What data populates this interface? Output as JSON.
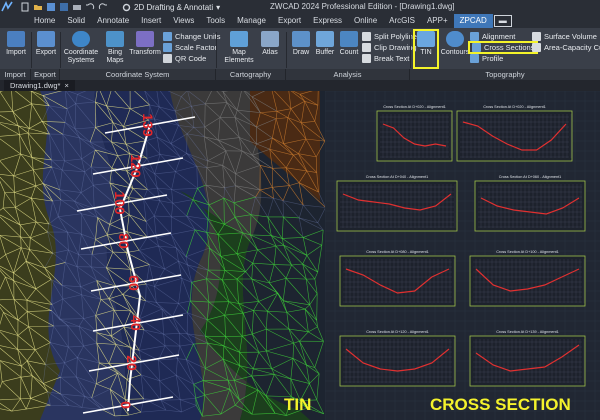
{
  "titlebar": {
    "workspace": "2D Drafting & Annotati",
    "title": "ZWCAD 2024 Professional Edition - [Drawing1.dwg]"
  },
  "tabs": [
    "Home",
    "Solid",
    "Annotate",
    "Insert",
    "Views",
    "Tools",
    "Manage",
    "Export",
    "Express",
    "Online",
    "ArcGIS",
    "APP+",
    "ZPCAD"
  ],
  "active_tab": "ZPCAD",
  "ribbon": {
    "import": "Import",
    "export": "Export",
    "coord_systems": "Coordinate Systems",
    "bing_maps": "Bing Maps",
    "transform": "Transform",
    "change_units": "Change Units",
    "scale_factor": "Scale Factor",
    "qr_code": "QR Code",
    "map_elements": "Map Elements",
    "atlas": "Atlas",
    "draw": "Draw",
    "buffer": "Buffer",
    "count": "Count",
    "split_polyline": "Split Polyline",
    "clip_drawing": "Clip Drawing",
    "break_text": "Break Text",
    "tin": "TIN",
    "contours": "Contours",
    "alignment": "Alignment",
    "cross_sections": "Cross Sections",
    "profile": "Profile",
    "surface_volume": "Surface Volume",
    "area_capacity": "Area-Capacity Curve",
    "groups": [
      "Import",
      "Export",
      "Coordinate System",
      "Cartography",
      "Analysis",
      "Topography"
    ]
  },
  "filetab": "Drawing1.dwg*",
  "stations": [
    "139",
    "120",
    "100",
    "80",
    "60",
    "40",
    "20",
    "0"
  ],
  "sections": [
    "Cross Section At D+020 - Alignment1",
    "Cross Section At D+020 - Alignment1",
    "Cross Section At D+040 - Alignment1",
    "Cross Section At D+060 - Alignment1",
    "Cross Section At D+080 - Alignment1",
    "Cross Section At D+100 - Alignment1",
    "Cross Section At D+120 - Alignment1",
    "Cross Section At D+139 - Alignment1"
  ],
  "labels": {
    "left": "TIN",
    "right": "CROSS SECTION"
  },
  "colors": {
    "accent": "#3f77b8",
    "highlight": "#f4f32a",
    "mesh_yellow": "#e6e28a",
    "mesh_green": "#3fd23a",
    "mesh_orange": "#c87a2e",
    "profile_red": "#e03030",
    "frame_green": "#9fc24a"
  }
}
